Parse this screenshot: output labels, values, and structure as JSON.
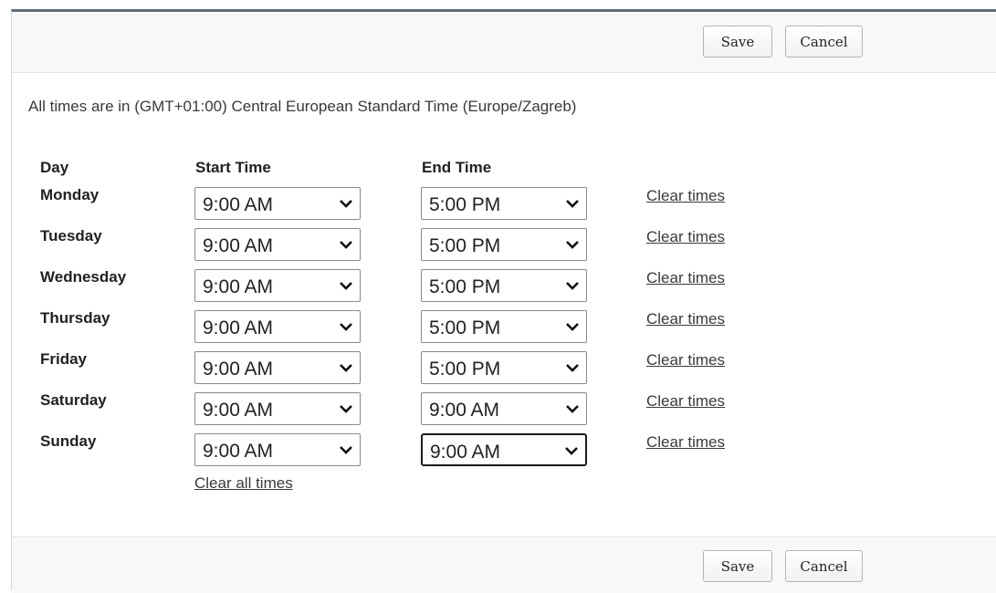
{
  "buttons": {
    "save_label": "Save",
    "cancel_label": "Cancel"
  },
  "timezone_note": "All times are in (GMT+01:00) Central European Standard Time (Europe/Zagreb)",
  "headers": {
    "day": "Day",
    "start": "Start Time",
    "end": "End Time"
  },
  "days": [
    {
      "name": "Monday",
      "start": "9:00 AM",
      "end": "5:00 PM",
      "clear_label": "Clear times"
    },
    {
      "name": "Tuesday",
      "start": "9:00 AM",
      "end": "5:00 PM",
      "clear_label": "Clear times"
    },
    {
      "name": "Wednesday",
      "start": "9:00 AM",
      "end": "5:00 PM",
      "clear_label": "Clear times"
    },
    {
      "name": "Thursday",
      "start": "9:00 AM",
      "end": "5:00 PM",
      "clear_label": "Clear times"
    },
    {
      "name": "Friday",
      "start": "9:00 AM",
      "end": "5:00 PM",
      "clear_label": "Clear times"
    },
    {
      "name": "Saturday",
      "start": "9:00 AM",
      "end": "9:00 AM",
      "clear_label": "Clear times"
    },
    {
      "name": "Sunday",
      "start": "9:00 AM",
      "end": "9:00 AM",
      "clear_label": "Clear times"
    }
  ],
  "focused_field": "Sunday end time",
  "clear_all_label": "Clear all times",
  "icons": {
    "dropdown": "chevron-down-icon"
  }
}
